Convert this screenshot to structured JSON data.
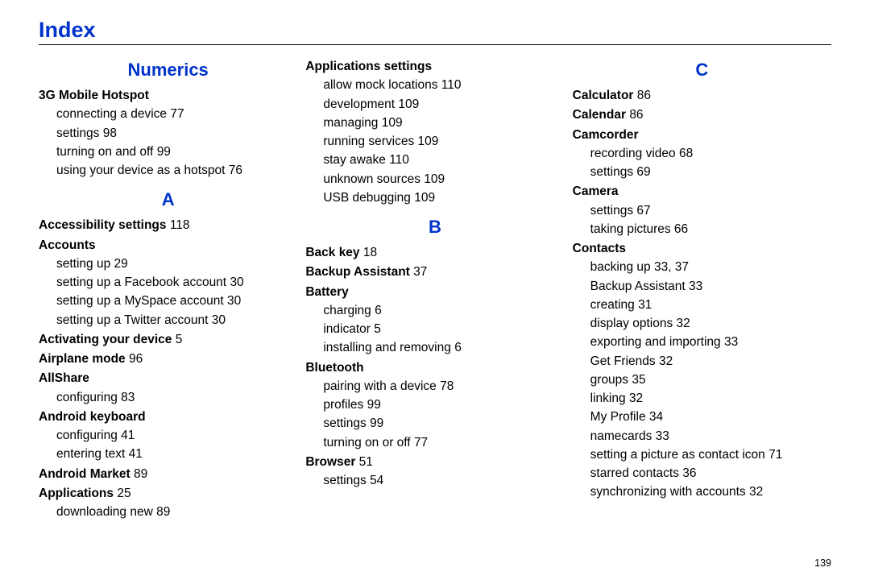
{
  "title": "Index",
  "page_number": "139",
  "sections": {
    "numerics": "Numerics",
    "a": "A",
    "b": "B",
    "c": "C"
  },
  "col1": {
    "e1": {
      "term": "3G Mobile Hotspot"
    },
    "e2": {
      "text": "connecting a device",
      "pg": "77"
    },
    "e3": {
      "text": "settings",
      "pg": "98"
    },
    "e4": {
      "text": "turning on and off",
      "pg": "99"
    },
    "e5": {
      "text": "using your device as a hotspot",
      "pg": "76"
    },
    "e6": {
      "term": "Accessibility settings",
      "pg": "118"
    },
    "e7": {
      "term": "Accounts"
    },
    "e8": {
      "text": "setting up",
      "pg": "29"
    },
    "e9": {
      "text": "setting up a Facebook account",
      "pg": "30"
    },
    "e10": {
      "text": "setting up a MySpace account",
      "pg": "30"
    },
    "e11": {
      "text": "setting up a Twitter account",
      "pg": "30"
    },
    "e12": {
      "term": "Activating your device",
      "pg": "5"
    },
    "e13": {
      "term": "Airplane mode",
      "pg": "96"
    },
    "e14": {
      "term": "AllShare"
    },
    "e15": {
      "text": "configuring",
      "pg": "83"
    },
    "e16": {
      "term": "Android keyboard"
    },
    "e17": {
      "text": "configuring",
      "pg": "41"
    },
    "e18": {
      "text": "entering text",
      "pg": "41"
    },
    "e19": {
      "term": "Android Market",
      "pg": "89"
    },
    "e20": {
      "term": "Applications",
      "pg": "25"
    },
    "e21": {
      "text": "downloading new",
      "pg": "89"
    }
  },
  "col2": {
    "e1": {
      "term": "Applications settings"
    },
    "e2": {
      "text": "allow mock locations",
      "pg": "110"
    },
    "e3": {
      "text": "development",
      "pg": "109"
    },
    "e4": {
      "text": "managing",
      "pg": "109"
    },
    "e5": {
      "text": "running services",
      "pg": "109"
    },
    "e6": {
      "text": "stay awake",
      "pg": "110"
    },
    "e7": {
      "text": "unknown sources",
      "pg": "109"
    },
    "e8": {
      "text": "USB debugging",
      "pg": "109"
    },
    "e9": {
      "term": "Back key",
      "pg": "18"
    },
    "e10": {
      "term": "Backup Assistant",
      "pg": "37"
    },
    "e11": {
      "term": "Battery"
    },
    "e12": {
      "text": "charging",
      "pg": "6"
    },
    "e13": {
      "text": "indicator",
      "pg": "5"
    },
    "e14": {
      "text": "installing and removing",
      "pg": "6"
    },
    "e15": {
      "term": "Bluetooth"
    },
    "e16": {
      "text": "pairing with a device",
      "pg": "78"
    },
    "e17": {
      "text": "profiles",
      "pg": "99"
    },
    "e18": {
      "text": "settings",
      "pg": "99"
    },
    "e19": {
      "text": "turning on or off",
      "pg": "77"
    },
    "e20": {
      "term": "Browser",
      "pg": "51"
    },
    "e21": {
      "text": "settings",
      "pg": "54"
    }
  },
  "col3": {
    "e1": {
      "term": "Calculator",
      "pg": "86"
    },
    "e2": {
      "term": "Calendar",
      "pg": "86"
    },
    "e3": {
      "term": "Camcorder"
    },
    "e4": {
      "text": "recording video",
      "pg": "68"
    },
    "e5": {
      "text": "settings",
      "pg": "69"
    },
    "e6": {
      "term": "Camera"
    },
    "e7": {
      "text": "settings",
      "pg": "67"
    },
    "e8": {
      "text": "taking pictures",
      "pg": "66"
    },
    "e9": {
      "term": "Contacts"
    },
    "e10": {
      "text": "backing up",
      "pg": "33, 37"
    },
    "e11": {
      "text": "Backup Assistant",
      "pg": "33"
    },
    "e12": {
      "text": "creating",
      "pg": "31"
    },
    "e13": {
      "text": "display options",
      "pg": "32"
    },
    "e14": {
      "text": "exporting and importing",
      "pg": "33"
    },
    "e15": {
      "text": "Get Friends",
      "pg": "32"
    },
    "e16": {
      "text": "groups",
      "pg": "35"
    },
    "e17": {
      "text": "linking",
      "pg": "32"
    },
    "e18": {
      "text": "My Profile",
      "pg": "34"
    },
    "e19": {
      "text": "namecards",
      "pg": "33"
    },
    "e20": {
      "text": "setting a picture as contact icon",
      "pg": "71"
    },
    "e21": {
      "text": "starred contacts",
      "pg": "36"
    },
    "e22": {
      "text": "synchronizing with accounts",
      "pg": "32"
    }
  }
}
